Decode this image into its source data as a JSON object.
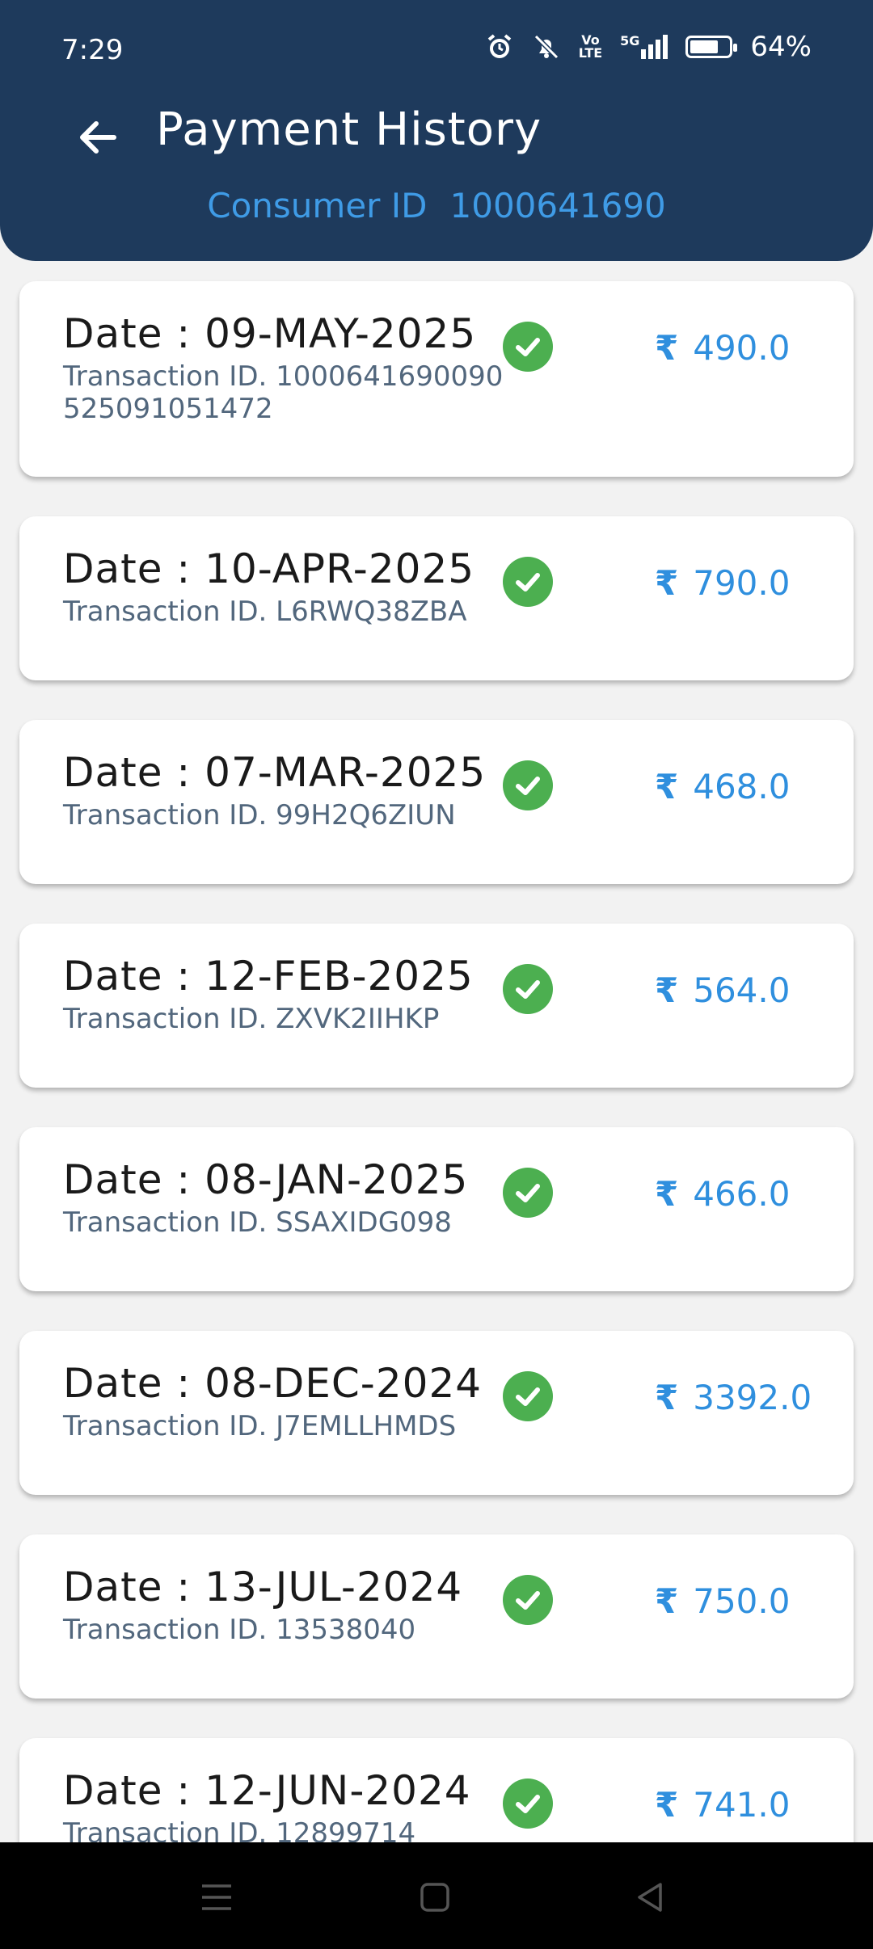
{
  "status_bar": {
    "time": "7:29",
    "network_label_top": "Vo",
    "network_label_bottom": "LTE",
    "network_5g": "5G",
    "battery": "64%",
    "battery_level": 0.64
  },
  "header": {
    "title": "Payment History",
    "consumer_label": "Consumer ID",
    "consumer_id": "1000641690",
    "colors": {
      "background": "#1e3a5c",
      "accent": "#3f9be6"
    }
  },
  "payments": [
    {
      "date": "Date : 09-MAY-2025",
      "transaction": "Transaction ID. 1000641690090525091051472",
      "amount": "490.0",
      "currency": "₹",
      "status": "success"
    },
    {
      "date": "Date : 10-APR-2025",
      "transaction": "Transaction ID. L6RWQ38ZBA",
      "amount": "790.0",
      "currency": "₹",
      "status": "success"
    },
    {
      "date": "Date : 07-MAR-2025",
      "transaction": "Transaction ID. 99H2Q6ZIUN",
      "amount": "468.0",
      "currency": "₹",
      "status": "success"
    },
    {
      "date": "Date : 12-FEB-2025",
      "transaction": "Transaction ID. ZXVK2IIHKP",
      "amount": "564.0",
      "currency": "₹",
      "status": "success"
    },
    {
      "date": "Date : 08-JAN-2025",
      "transaction": "Transaction ID. SSAXIDG098",
      "amount": "466.0",
      "currency": "₹",
      "status": "success"
    },
    {
      "date": "Date : 08-DEC-2024",
      "transaction": "Transaction ID. J7EMLLHMDS",
      "amount": "3392.0",
      "currency": "₹",
      "status": "success"
    },
    {
      "date": "Date : 13-JUL-2024",
      "transaction": "Transaction ID. 13538040",
      "amount": "750.0",
      "currency": "₹",
      "status": "success"
    },
    {
      "date": "Date : 12-JUN-2024",
      "transaction": "Transaction ID. 12899714",
      "amount": "741.0",
      "currency": "₹",
      "status": "success"
    }
  ],
  "icons": {
    "back": "arrow-left-icon",
    "status": "check-circle-icon",
    "nav": [
      "menu-icon",
      "home-square-icon",
      "back-triangle-icon"
    ]
  }
}
